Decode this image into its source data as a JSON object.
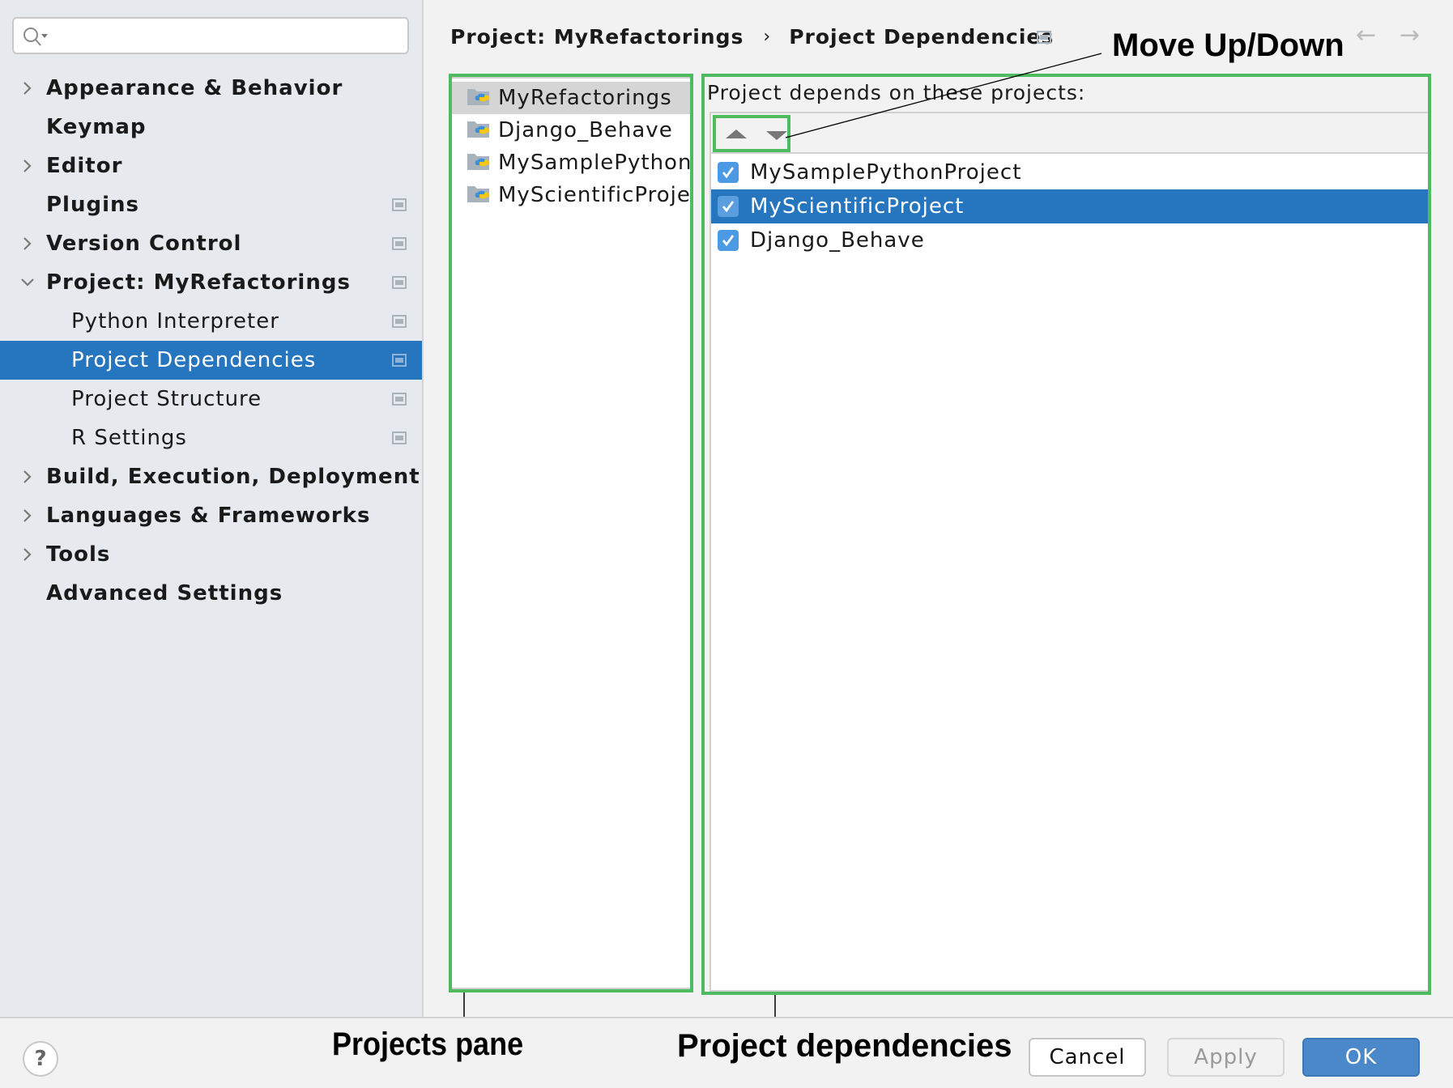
{
  "search": {
    "placeholder": "",
    "icon": "search-icon"
  },
  "sidebar": {
    "items": [
      {
        "label": "Appearance & Behavior",
        "bold": true,
        "expandable": true,
        "expanded": false,
        "has_project_icon": false
      },
      {
        "label": "Keymap",
        "bold": true,
        "expandable": false,
        "has_project_icon": false
      },
      {
        "label": "Editor",
        "bold": true,
        "expandable": true,
        "expanded": false,
        "has_project_icon": false
      },
      {
        "label": "Plugins",
        "bold": true,
        "expandable": false,
        "has_project_icon": true
      },
      {
        "label": "Version Control",
        "bold": true,
        "expandable": true,
        "expanded": false,
        "has_project_icon": true
      },
      {
        "label": "Project: MyRefactorings",
        "bold": true,
        "expandable": true,
        "expanded": true,
        "has_project_icon": true
      },
      {
        "label": "Python Interpreter",
        "bold": false,
        "sub": true,
        "has_project_icon": true
      },
      {
        "label": "Project Dependencies",
        "bold": false,
        "sub": true,
        "selected": true,
        "has_project_icon": true
      },
      {
        "label": "Project Structure",
        "bold": false,
        "sub": true,
        "has_project_icon": true
      },
      {
        "label": "R Settings",
        "bold": false,
        "sub": true,
        "has_project_icon": true
      },
      {
        "label": "Build, Execution, Deployment",
        "bold": true,
        "expandable": true,
        "expanded": false,
        "has_project_icon": false
      },
      {
        "label": "Languages & Frameworks",
        "bold": true,
        "expandable": true,
        "expanded": false,
        "has_project_icon": false
      },
      {
        "label": "Tools",
        "bold": true,
        "expandable": true,
        "expanded": false,
        "has_project_icon": false
      },
      {
        "label": "Advanced Settings",
        "bold": true,
        "expandable": false,
        "has_project_icon": false
      }
    ]
  },
  "header": {
    "breadcrumb": [
      "Project: MyRefactorings",
      "Project Dependencies"
    ],
    "separator": "›",
    "back_icon": "←",
    "forward_icon": "→"
  },
  "projects_pane": {
    "items": [
      {
        "name": "MyRefactorings",
        "selected": true
      },
      {
        "name": "Django_Behave",
        "selected": false
      },
      {
        "name": "MySamplePythonProject",
        "selected": false
      },
      {
        "name": "MyScientificProject",
        "selected": false
      }
    ]
  },
  "dependencies_pane": {
    "title": "Project depends on these projects:",
    "toolbar": {
      "move_up": "Move Up",
      "move_down": "Move Down"
    },
    "items": [
      {
        "name": "MySamplePythonProject",
        "checked": true,
        "selected": false
      },
      {
        "name": "MyScientificProject",
        "checked": true,
        "selected": true
      },
      {
        "name": "Django_Behave",
        "checked": true,
        "selected": false
      }
    ]
  },
  "annotations": {
    "move_up_down": "Move Up/Down",
    "projects_pane": "Projects pane",
    "project_dependencies": "Project dependencies"
  },
  "footer": {
    "help": "?",
    "cancel": "Cancel",
    "apply": "Apply",
    "ok": "OK"
  },
  "colors": {
    "selection": "#2675bf",
    "annotation_frame": "#4fbb5f",
    "checkbox": "#4c9ae4",
    "ok_button": "#4a88c9"
  }
}
